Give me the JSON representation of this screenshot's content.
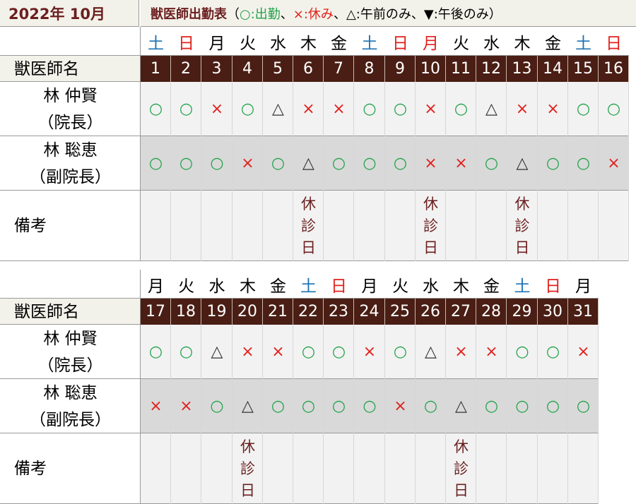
{
  "header": {
    "date": "2022年 10月",
    "legend_title": "獣医師出勤表",
    "legend_open": "（",
    "legend_o": "○:出勤",
    "legend_sep1": "、",
    "legend_x": "×:休み",
    "legend_sep2": "、",
    "legend_t": "△:午前のみ",
    "legend_sep3": "、",
    "legend_v": "▼:午後のみ",
    "legend_close": "）"
  },
  "colors": {
    "title": "#6b1f1f",
    "day_header_bg": "#4a1e14",
    "present": "#22a24a",
    "absent": "#e0201c",
    "saturday": "#1b72b4",
    "sunday": "#e0201c"
  },
  "labels": {
    "name_header": "獣医師名",
    "remarks": "備考"
  },
  "doctors": [
    {
      "name": "林 仲賢",
      "role": "（院長）"
    },
    {
      "name": "林 聡恵",
      "role": "（副院長）"
    }
  ],
  "schedule": [
    {
      "days": [
        {
          "weekday": "土",
          "type": "sat",
          "day": "1",
          "marks": [
            "○",
            "○"
          ],
          "note": ""
        },
        {
          "weekday": "日",
          "type": "sun",
          "day": "2",
          "marks": [
            "○",
            "○"
          ],
          "note": ""
        },
        {
          "weekday": "月",
          "type": "wd",
          "day": "3",
          "marks": [
            "×",
            "○"
          ],
          "note": ""
        },
        {
          "weekday": "火",
          "type": "wd",
          "day": "4",
          "marks": [
            "○",
            "×"
          ],
          "note": ""
        },
        {
          "weekday": "水",
          "type": "wd",
          "day": "5",
          "marks": [
            "△",
            "○"
          ],
          "note": ""
        },
        {
          "weekday": "木",
          "type": "wd",
          "day": "6",
          "marks": [
            "×",
            "△"
          ],
          "note": "休診日"
        },
        {
          "weekday": "金",
          "type": "wd",
          "day": "7",
          "marks": [
            "×",
            "○"
          ],
          "note": ""
        },
        {
          "weekday": "土",
          "type": "sat",
          "day": "8",
          "marks": [
            "○",
            "○"
          ],
          "note": ""
        },
        {
          "weekday": "日",
          "type": "sun",
          "day": "9",
          "marks": [
            "○",
            "○"
          ],
          "note": ""
        },
        {
          "weekday": "月",
          "type": "sun",
          "day": "10",
          "marks": [
            "×",
            "×"
          ],
          "note": "休診日"
        },
        {
          "weekday": "火",
          "type": "wd",
          "day": "11",
          "marks": [
            "○",
            "×"
          ],
          "note": ""
        },
        {
          "weekday": "水",
          "type": "wd",
          "day": "12",
          "marks": [
            "△",
            "○"
          ],
          "note": ""
        },
        {
          "weekday": "木",
          "type": "wd",
          "day": "13",
          "marks": [
            "×",
            "△"
          ],
          "note": "休診日"
        },
        {
          "weekday": "金",
          "type": "wd",
          "day": "14",
          "marks": [
            "×",
            "○"
          ],
          "note": ""
        },
        {
          "weekday": "土",
          "type": "sat",
          "day": "15",
          "marks": [
            "○",
            "○"
          ],
          "note": ""
        },
        {
          "weekday": "日",
          "type": "sun",
          "day": "16",
          "marks": [
            "○",
            "×"
          ],
          "note": ""
        }
      ]
    },
    {
      "days": [
        {
          "weekday": "月",
          "type": "wd",
          "day": "17",
          "marks": [
            "○",
            "×"
          ],
          "note": ""
        },
        {
          "weekday": "火",
          "type": "wd",
          "day": "18",
          "marks": [
            "○",
            "×"
          ],
          "note": ""
        },
        {
          "weekday": "水",
          "type": "wd",
          "day": "19",
          "marks": [
            "△",
            "○"
          ],
          "note": ""
        },
        {
          "weekday": "木",
          "type": "wd",
          "day": "20",
          "marks": [
            "×",
            "△"
          ],
          "note": "休診日"
        },
        {
          "weekday": "金",
          "type": "wd",
          "day": "21",
          "marks": [
            "×",
            "○"
          ],
          "note": ""
        },
        {
          "weekday": "土",
          "type": "sat",
          "day": "22",
          "marks": [
            "○",
            "○"
          ],
          "note": ""
        },
        {
          "weekday": "日",
          "type": "sun",
          "day": "23",
          "marks": [
            "○",
            "○"
          ],
          "note": ""
        },
        {
          "weekday": "月",
          "type": "wd",
          "day": "24",
          "marks": [
            "×",
            "○"
          ],
          "note": ""
        },
        {
          "weekday": "火",
          "type": "wd",
          "day": "25",
          "marks": [
            "○",
            "×"
          ],
          "note": ""
        },
        {
          "weekday": "水",
          "type": "wd",
          "day": "26",
          "marks": [
            "△",
            "○"
          ],
          "note": ""
        },
        {
          "weekday": "木",
          "type": "wd",
          "day": "27",
          "marks": [
            "×",
            "△"
          ],
          "note": "休診日"
        },
        {
          "weekday": "金",
          "type": "wd",
          "day": "28",
          "marks": [
            "×",
            "○"
          ],
          "note": ""
        },
        {
          "weekday": "土",
          "type": "sat",
          "day": "29",
          "marks": [
            "○",
            "○"
          ],
          "note": ""
        },
        {
          "weekday": "日",
          "type": "sun",
          "day": "30",
          "marks": [
            "○",
            "○"
          ],
          "note": ""
        },
        {
          "weekday": "月",
          "type": "wd",
          "day": "31",
          "marks": [
            "×",
            "○"
          ],
          "note": ""
        }
      ]
    }
  ]
}
